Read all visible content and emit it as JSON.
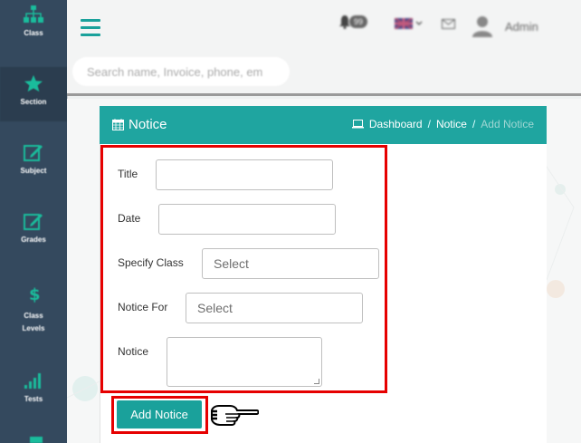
{
  "sidebar": {
    "items": [
      {
        "label": "Class",
        "icon": "sitemap-icon"
      },
      {
        "label": "Section",
        "icon": "star-icon"
      },
      {
        "label": "Subject",
        "icon": "edit-icon"
      },
      {
        "label": "Grades",
        "icon": "edit-icon"
      },
      {
        "label_line1": "Class",
        "label_line2": "Levels",
        "icon": "dollar-icon"
      },
      {
        "label": "Tests",
        "icon": "signal-icon"
      }
    ]
  },
  "topbar": {
    "badge": "99",
    "user": "Admin",
    "search_placeholder": "Search name, Invoice, phone, em"
  },
  "card": {
    "title": "Notice",
    "breadcrumb": {
      "dashboard": "Dashboard",
      "notice": "Notice",
      "current": "Add Notice",
      "separator": "/"
    }
  },
  "form": {
    "title_label": "Title",
    "date_label": "Date",
    "class_label": "Specify Class",
    "class_value": "Select",
    "notice_for_label": "Notice For",
    "notice_for_value": "Select",
    "notice_label": "Notice",
    "submit_label": "Add Notice"
  },
  "colors": {
    "accent": "#1fa5a0",
    "sidebar": "#34495e",
    "highlight": "#e60000"
  }
}
